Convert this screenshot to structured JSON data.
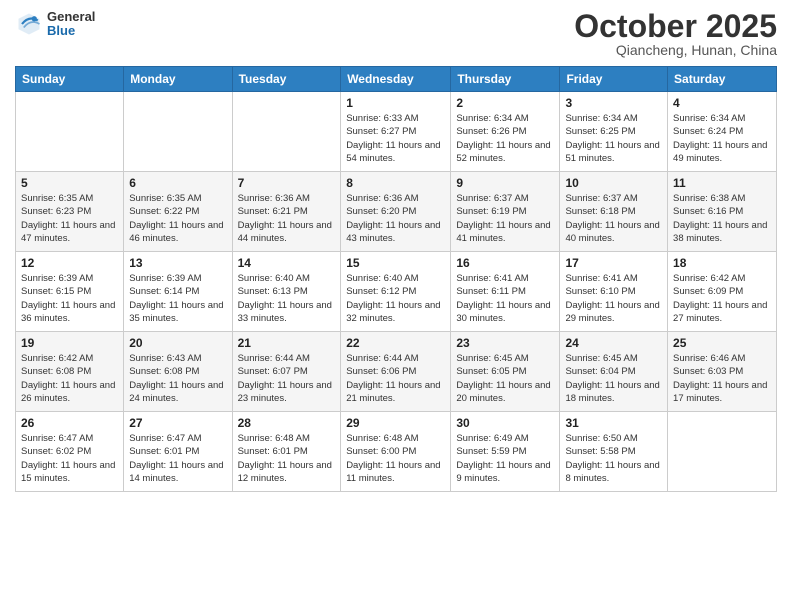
{
  "header": {
    "logo_general": "General",
    "logo_blue": "Blue",
    "month_title": "October 2025",
    "subtitle": "Qiancheng, Hunan, China"
  },
  "days_of_week": [
    "Sunday",
    "Monday",
    "Tuesday",
    "Wednesday",
    "Thursday",
    "Friday",
    "Saturday"
  ],
  "weeks": [
    [
      {
        "day": "",
        "info": ""
      },
      {
        "day": "",
        "info": ""
      },
      {
        "day": "",
        "info": ""
      },
      {
        "day": "1",
        "info": "Sunrise: 6:33 AM\nSunset: 6:27 PM\nDaylight: 11 hours and 54 minutes."
      },
      {
        "day": "2",
        "info": "Sunrise: 6:34 AM\nSunset: 6:26 PM\nDaylight: 11 hours and 52 minutes."
      },
      {
        "day": "3",
        "info": "Sunrise: 6:34 AM\nSunset: 6:25 PM\nDaylight: 11 hours and 51 minutes."
      },
      {
        "day": "4",
        "info": "Sunrise: 6:34 AM\nSunset: 6:24 PM\nDaylight: 11 hours and 49 minutes."
      }
    ],
    [
      {
        "day": "5",
        "info": "Sunrise: 6:35 AM\nSunset: 6:23 PM\nDaylight: 11 hours and 47 minutes."
      },
      {
        "day": "6",
        "info": "Sunrise: 6:35 AM\nSunset: 6:22 PM\nDaylight: 11 hours and 46 minutes."
      },
      {
        "day": "7",
        "info": "Sunrise: 6:36 AM\nSunset: 6:21 PM\nDaylight: 11 hours and 44 minutes."
      },
      {
        "day": "8",
        "info": "Sunrise: 6:36 AM\nSunset: 6:20 PM\nDaylight: 11 hours and 43 minutes."
      },
      {
        "day": "9",
        "info": "Sunrise: 6:37 AM\nSunset: 6:19 PM\nDaylight: 11 hours and 41 minutes."
      },
      {
        "day": "10",
        "info": "Sunrise: 6:37 AM\nSunset: 6:18 PM\nDaylight: 11 hours and 40 minutes."
      },
      {
        "day": "11",
        "info": "Sunrise: 6:38 AM\nSunset: 6:16 PM\nDaylight: 11 hours and 38 minutes."
      }
    ],
    [
      {
        "day": "12",
        "info": "Sunrise: 6:39 AM\nSunset: 6:15 PM\nDaylight: 11 hours and 36 minutes."
      },
      {
        "day": "13",
        "info": "Sunrise: 6:39 AM\nSunset: 6:14 PM\nDaylight: 11 hours and 35 minutes."
      },
      {
        "day": "14",
        "info": "Sunrise: 6:40 AM\nSunset: 6:13 PM\nDaylight: 11 hours and 33 minutes."
      },
      {
        "day": "15",
        "info": "Sunrise: 6:40 AM\nSunset: 6:12 PM\nDaylight: 11 hours and 32 minutes."
      },
      {
        "day": "16",
        "info": "Sunrise: 6:41 AM\nSunset: 6:11 PM\nDaylight: 11 hours and 30 minutes."
      },
      {
        "day": "17",
        "info": "Sunrise: 6:41 AM\nSunset: 6:10 PM\nDaylight: 11 hours and 29 minutes."
      },
      {
        "day": "18",
        "info": "Sunrise: 6:42 AM\nSunset: 6:09 PM\nDaylight: 11 hours and 27 minutes."
      }
    ],
    [
      {
        "day": "19",
        "info": "Sunrise: 6:42 AM\nSunset: 6:08 PM\nDaylight: 11 hours and 26 minutes."
      },
      {
        "day": "20",
        "info": "Sunrise: 6:43 AM\nSunset: 6:08 PM\nDaylight: 11 hours and 24 minutes."
      },
      {
        "day": "21",
        "info": "Sunrise: 6:44 AM\nSunset: 6:07 PM\nDaylight: 11 hours and 23 minutes."
      },
      {
        "day": "22",
        "info": "Sunrise: 6:44 AM\nSunset: 6:06 PM\nDaylight: 11 hours and 21 minutes."
      },
      {
        "day": "23",
        "info": "Sunrise: 6:45 AM\nSunset: 6:05 PM\nDaylight: 11 hours and 20 minutes."
      },
      {
        "day": "24",
        "info": "Sunrise: 6:45 AM\nSunset: 6:04 PM\nDaylight: 11 hours and 18 minutes."
      },
      {
        "day": "25",
        "info": "Sunrise: 6:46 AM\nSunset: 6:03 PM\nDaylight: 11 hours and 17 minutes."
      }
    ],
    [
      {
        "day": "26",
        "info": "Sunrise: 6:47 AM\nSunset: 6:02 PM\nDaylight: 11 hours and 15 minutes."
      },
      {
        "day": "27",
        "info": "Sunrise: 6:47 AM\nSunset: 6:01 PM\nDaylight: 11 hours and 14 minutes."
      },
      {
        "day": "28",
        "info": "Sunrise: 6:48 AM\nSunset: 6:01 PM\nDaylight: 11 hours and 12 minutes."
      },
      {
        "day": "29",
        "info": "Sunrise: 6:48 AM\nSunset: 6:00 PM\nDaylight: 11 hours and 11 minutes."
      },
      {
        "day": "30",
        "info": "Sunrise: 6:49 AM\nSunset: 5:59 PM\nDaylight: 11 hours and 9 minutes."
      },
      {
        "day": "31",
        "info": "Sunrise: 6:50 AM\nSunset: 5:58 PM\nDaylight: 11 hours and 8 minutes."
      },
      {
        "day": "",
        "info": ""
      }
    ]
  ]
}
